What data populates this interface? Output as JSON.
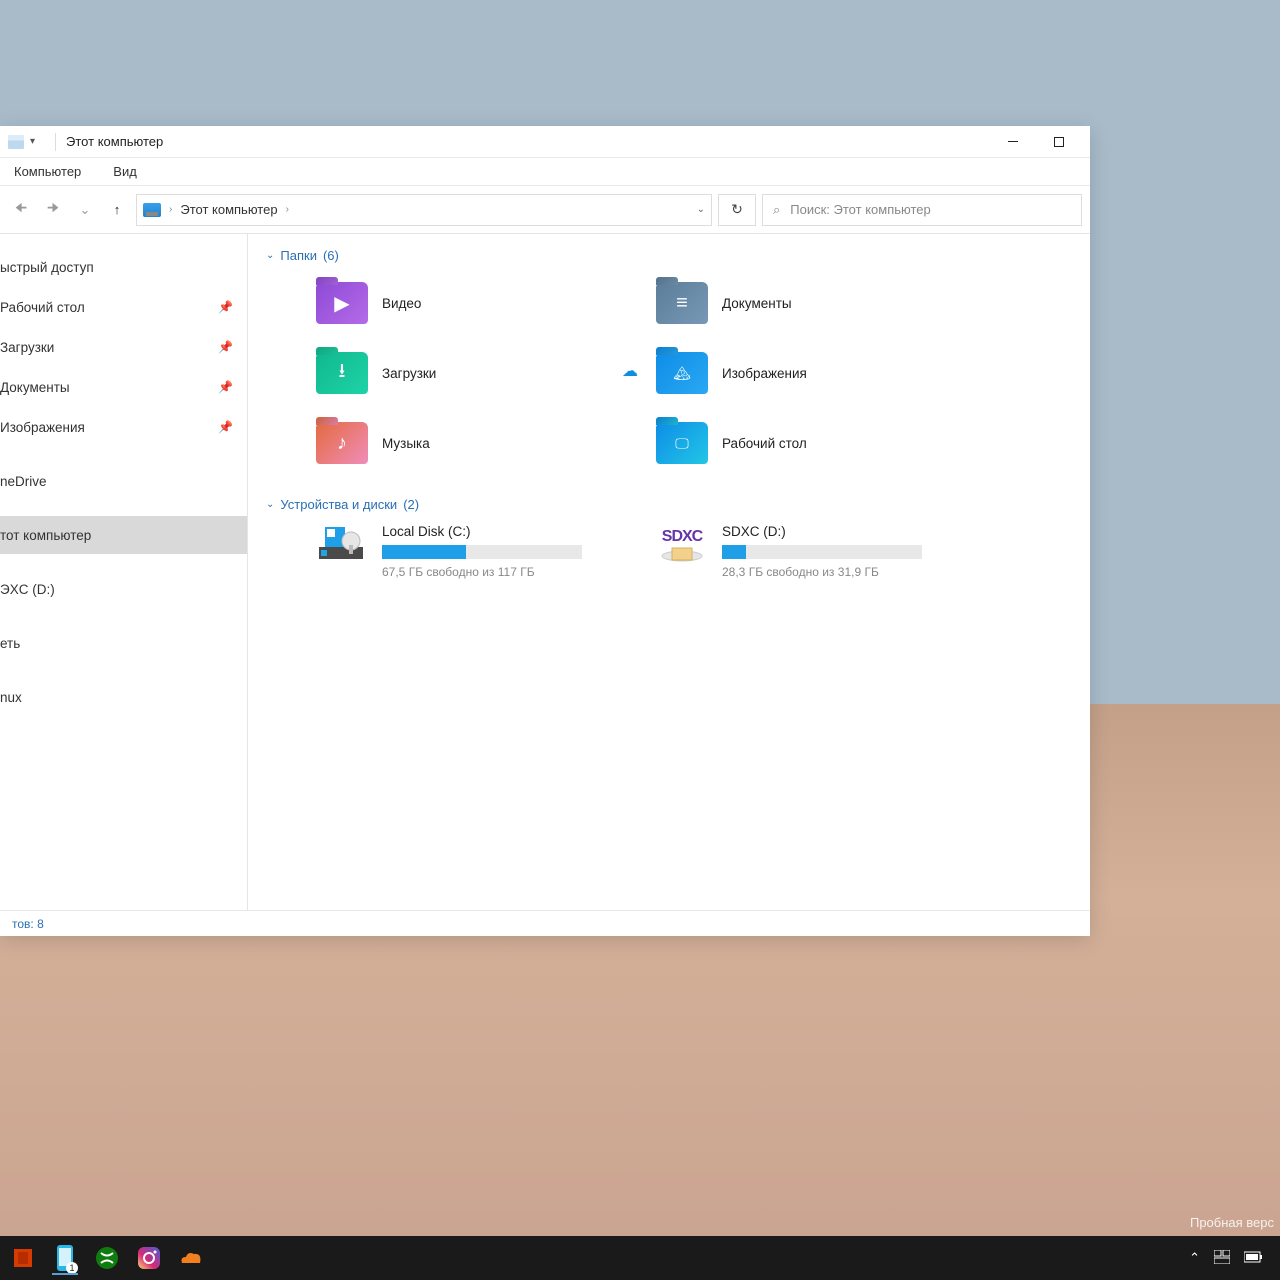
{
  "window": {
    "title": "Этот компьютер"
  },
  "menubar": {
    "computer": "Компьютер",
    "view": "Вид"
  },
  "address": {
    "root": "Этот компьютер"
  },
  "search": {
    "placeholder": "Поиск: Этот компьютер"
  },
  "sidebar": {
    "quick_access": "ыстрый доступ",
    "desktop": "Рабочий стол",
    "downloads": "Загрузки",
    "documents": "Документы",
    "images": "Изображения",
    "onedrive": "neDrive",
    "this_pc": "тот компьютер",
    "sdxc": "ЭXC (D:)",
    "network": "еть",
    "linux": "nux"
  },
  "groups": {
    "folders": {
      "label": "Папки",
      "count": "(6)"
    },
    "devices": {
      "label": "Устройства и диски",
      "count": "(2)"
    }
  },
  "folders": {
    "video": "Видео",
    "documents": "Документы",
    "downloads": "Загрузки",
    "images": "Изображения",
    "music": "Музыка",
    "desktop": "Рабочий стол"
  },
  "drives": {
    "c": {
      "name": "Local Disk (C:)",
      "caption": "67,5 ГБ свободно из 117 ГБ",
      "fill_pct": 42
    },
    "d": {
      "name": "SDXC (D:)",
      "icon_text": "SDXC",
      "caption": "28,3 ГБ свободно из 31,9 ГБ",
      "fill_pct": 12
    }
  },
  "statusbar": {
    "items": "тов: 8"
  },
  "watermark": "Пробная верс",
  "taskbar": {
    "phone_badge": "1"
  }
}
